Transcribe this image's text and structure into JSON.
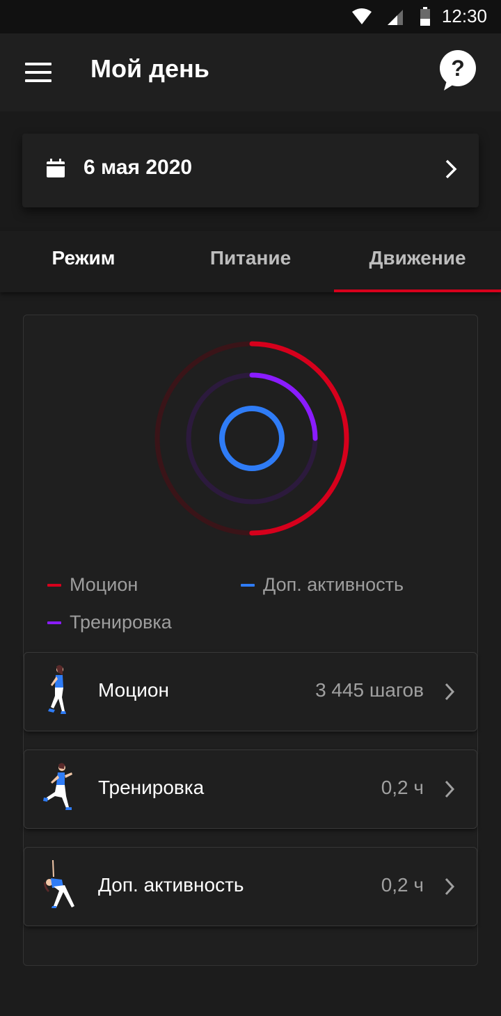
{
  "status_bar": {
    "time": "12:30"
  },
  "app_bar": {
    "title": "Мой день"
  },
  "date_selector": {
    "date": "6 мая 2020"
  },
  "tabs": [
    {
      "label": "Режим"
    },
    {
      "label": "Питание"
    },
    {
      "label": "Движение"
    }
  ],
  "active_tab": "Движение",
  "activity_rings": {
    "motion_color": "#d6001c",
    "training_color": "#8a1cff",
    "extra_color": "#2f7cf6",
    "motion_progress": 0.5,
    "training_progress": 0.25,
    "extra_progress": 1.0
  },
  "legend": [
    {
      "label": "Моцион",
      "color": "#d6001c"
    },
    {
      "label": "Доп. активность",
      "color": "#2f7cf6"
    },
    {
      "label": "Тренировка",
      "color": "#8a1cff"
    }
  ],
  "activities": [
    {
      "label": "Моцион",
      "value": "3 445 шагов",
      "icon": "walking-person-icon"
    },
    {
      "label": "Тренировка",
      "value": "0,2 ч",
      "icon": "running-person-icon"
    },
    {
      "label": "Доп. активность",
      "value": "0,2 ч",
      "icon": "stretching-person-icon"
    }
  ]
}
